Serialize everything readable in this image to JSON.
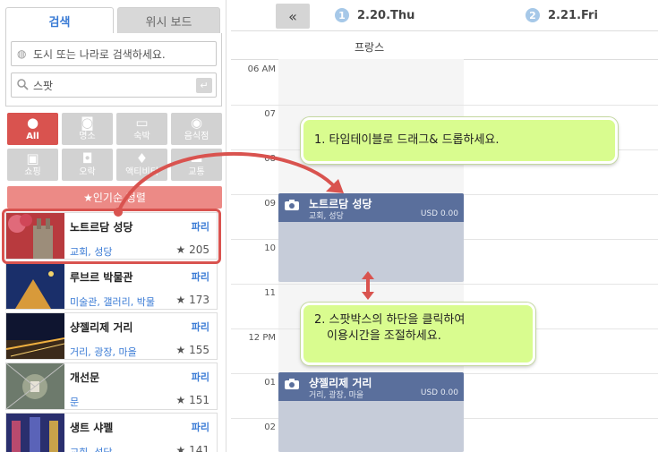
{
  "tabs": {
    "search": "검색",
    "wishlist": "위시 보드"
  },
  "search": {
    "city_placeholder": "도시 또는 나라로 검색하세요.",
    "spot_value": "스팟"
  },
  "categories": [
    {
      "label": "All",
      "icon": "pin-icon",
      "active": true
    },
    {
      "label": "명소",
      "icon": "camera-icon",
      "active": false
    },
    {
      "label": "숙박",
      "icon": "bed-icon",
      "active": false
    },
    {
      "label": "음식점",
      "icon": "restaurant-icon",
      "active": false
    },
    {
      "label": "쇼핑",
      "icon": "shopping-bag-icon",
      "active": false
    },
    {
      "label": "오락",
      "icon": "film-camera-icon",
      "active": false
    },
    {
      "label": "액티비티",
      "icon": "running-icon",
      "active": false
    },
    {
      "label": "교통",
      "icon": "car-icon",
      "active": false
    }
  ],
  "popular_sort": "★인기순 정렬",
  "spots": [
    {
      "name": "노트르담 성당",
      "city": "파리",
      "category": "교회, 성당",
      "score": "205"
    },
    {
      "name": "루브르 박물관",
      "city": "파리",
      "category": "미술관, 갤러리, 박물",
      "score": "173"
    },
    {
      "name": "샹젤리제 거리",
      "city": "파리",
      "category": "거리, 광장, 마을",
      "score": "155"
    },
    {
      "name": "개선문",
      "city": "파리",
      "category": "문",
      "score": "151"
    },
    {
      "name": "생트 샤펠",
      "city": "파리",
      "category": "교회, 성당",
      "score": "141"
    }
  ],
  "calendar": {
    "collapse": "«",
    "days": [
      {
        "num": "1",
        "label": "2.20.Thu"
      },
      {
        "num": "2",
        "label": "2.21.Fri"
      }
    ],
    "country": "프랑스",
    "hours": [
      "06 AM",
      "07",
      "08",
      "09",
      "10",
      "11",
      "12 PM",
      "01",
      "02"
    ]
  },
  "events": [
    {
      "title": "노트르담 성당",
      "sub": "교회, 성당",
      "price": "USD 0.00"
    },
    {
      "title": "샹젤리제 거리",
      "sub": "거리, 광장, 마을",
      "price": "USD 0.00"
    }
  ],
  "tips": {
    "drag": "1. 타임테이블로 드래그& 드롭하세요.",
    "resize_line1": "2. 스팟박스의 하단을 클릭하여",
    "resize_line2": "이용시간을 조절하세요."
  },
  "colors": {
    "accent_red": "#d9534f",
    "tip_green": "#d9fc8f",
    "event_header": "#5a6f9c",
    "link_blue": "#3a7bd5"
  }
}
